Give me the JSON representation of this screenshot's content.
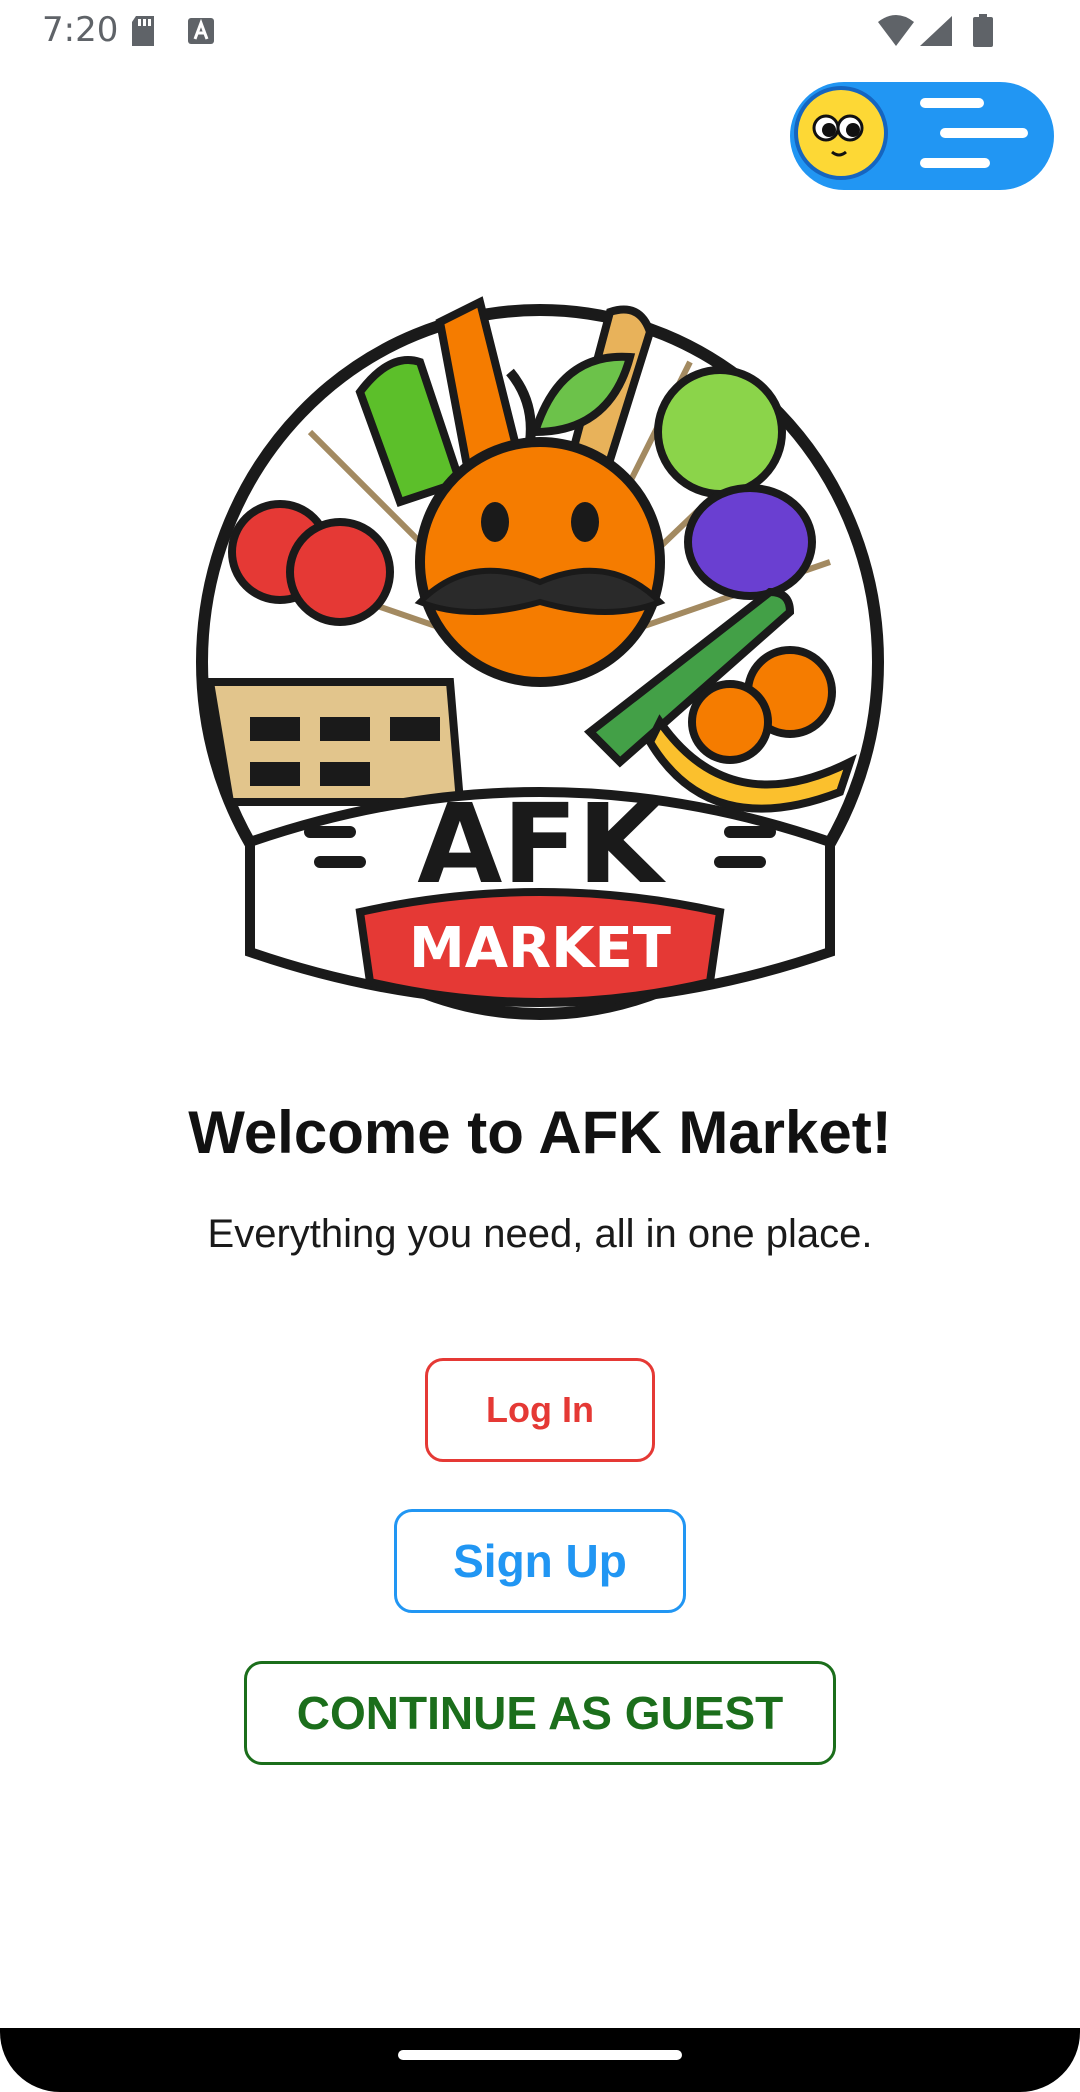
{
  "status_bar": {
    "time": "7:20",
    "icons": [
      "sd-card-icon",
      "accessibility-a-icon",
      "wifi-icon",
      "signal-icon",
      "battery-icon"
    ]
  },
  "assistant": {
    "icon": "assistant-bubble-icon"
  },
  "logo": {
    "brand": "AFK",
    "sub_brand": "MARKET"
  },
  "welcome": {
    "title": "Welcome to AFK Market!",
    "subtitle": "Everything you need, all in one place."
  },
  "actions": {
    "login_label": "Log In",
    "signup_label": "Sign Up",
    "guest_label": "CONTINUE AS GUEST"
  },
  "colors": {
    "login": "#e53935",
    "signup": "#2196f3",
    "guest": "#1b6e1b",
    "assistant": "#2196f3"
  }
}
